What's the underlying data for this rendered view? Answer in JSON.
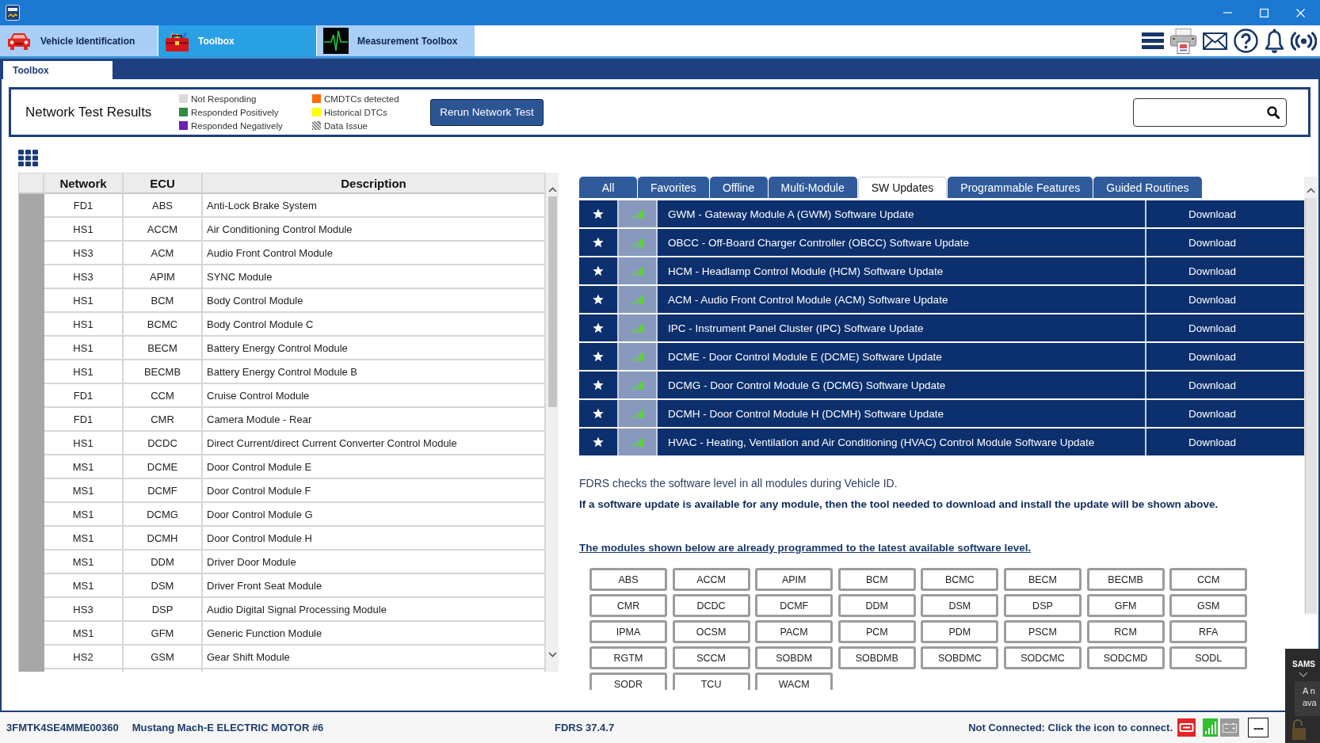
{
  "app_tabs": [
    {
      "label": "Vehicle Identification",
      "kind": "car",
      "selected": false
    },
    {
      "label": "Toolbox",
      "kind": "toolbox",
      "selected": true
    },
    {
      "label": "Measurement Toolbox",
      "kind": "waveform",
      "selected": false
    }
  ],
  "sub_tabs": [
    {
      "label": "Toolbox",
      "selected": true
    }
  ],
  "network_test": {
    "title": "Network Test Results",
    "legend": [
      {
        "label": "Not Responding",
        "kind": "solid",
        "color": "#d9d9d9"
      },
      {
        "label": "Responded Positively",
        "kind": "solid",
        "color": "#2e8b3f"
      },
      {
        "label": "Responded Negatively",
        "kind": "solid",
        "color": "#6a1fb5"
      },
      {
        "label": "CMDTCs detected",
        "kind": "solid",
        "color": "#ff6c0a"
      },
      {
        "label": "Historical DTCs",
        "kind": "solid",
        "color": "#ffff00"
      },
      {
        "label": "Data Issue",
        "kind": "hatched",
        "color": "#7f7f7f"
      }
    ],
    "rerun_button": "Rerun Network Test"
  },
  "ecu_table": {
    "columns": [
      "Network",
      "ECU",
      "Description"
    ],
    "rows": [
      {
        "network": "FD1",
        "ecu": "ABS",
        "description": "Anti-Lock Brake System"
      },
      {
        "network": "HS1",
        "ecu": "ACCM",
        "description": "Air Conditioning Control Module"
      },
      {
        "network": "HS3",
        "ecu": "ACM",
        "description": "Audio Front Control Module"
      },
      {
        "network": "HS3",
        "ecu": "APIM",
        "description": "SYNC Module"
      },
      {
        "network": "HS1",
        "ecu": "BCM",
        "description": "Body Control Module"
      },
      {
        "network": "HS1",
        "ecu": "BCMC",
        "description": "Body Control Module C"
      },
      {
        "network": "HS1",
        "ecu": "BECM",
        "description": "Battery Energy Control Module"
      },
      {
        "network": "HS1",
        "ecu": "BECMB",
        "description": "Battery Energy Control Module B"
      },
      {
        "network": "FD1",
        "ecu": "CCM",
        "description": "Cruise Control Module"
      },
      {
        "network": "FD1",
        "ecu": "CMR",
        "description": "Camera Module - Rear"
      },
      {
        "network": "HS1",
        "ecu": "DCDC",
        "description": "Direct Current/direct Current Converter Control Module"
      },
      {
        "network": "MS1",
        "ecu": "DCME",
        "description": "Door Control Module E"
      },
      {
        "network": "MS1",
        "ecu": "DCMF",
        "description": "Door Control Module F"
      },
      {
        "network": "MS1",
        "ecu": "DCMG",
        "description": "Door Control Module G"
      },
      {
        "network": "MS1",
        "ecu": "DCMH",
        "description": "Door Control Module H"
      },
      {
        "network": "MS1",
        "ecu": "DDM",
        "description": "Driver Door Module"
      },
      {
        "network": "MS1",
        "ecu": "DSM",
        "description": "Driver Front Seat Module"
      },
      {
        "network": "HS3",
        "ecu": "DSP",
        "description": "Audio Digital Signal Processing Module"
      },
      {
        "network": "MS1",
        "ecu": "GFM",
        "description": "Generic Function Module"
      },
      {
        "network": "HS2",
        "ecu": "GSM",
        "description": "Gear Shift Module"
      }
    ]
  },
  "filter_tabs": [
    {
      "label": "All",
      "selected": false
    },
    {
      "label": "Favorites",
      "selected": false
    },
    {
      "label": "Offline",
      "selected": false
    },
    {
      "label": "Multi-Module",
      "selected": false
    },
    {
      "label": "SW Updates",
      "selected": true
    },
    {
      "label": "Programmable Features",
      "selected": false
    },
    {
      "label": "Guided Routines",
      "selected": false
    }
  ],
  "sw_updates": [
    {
      "title": "GWM - Gateway Module A (GWM) Software Update",
      "action": "Download"
    },
    {
      "title": "OBCC - Off-Board Charger Controller (OBCC) Software Update",
      "action": "Download"
    },
    {
      "title": "HCM - Headlamp Control Module (HCM) Software Update",
      "action": "Download"
    },
    {
      "title": "ACM - Audio Front Control Module (ACM) Software Update",
      "action": "Download"
    },
    {
      "title": "IPC - Instrument Panel Cluster (IPC) Software Update",
      "action": "Download"
    },
    {
      "title": "DCME - Door Control Module E (DCME) Software Update",
      "action": "Download"
    },
    {
      "title": "DCMG - Door Control Module G (DCMG) Software Update",
      "action": "Download"
    },
    {
      "title": "DCMH - Door Control Module H (DCMH) Software Update",
      "action": "Download"
    },
    {
      "title": "HVAC - Heating, Ventilation and Air Conditioning (HVAC) Control Module Software Update",
      "action": "Download"
    }
  ],
  "notes": {
    "info": "FDRS checks the software level in all modules during Vehicle ID.",
    "instruction": "If a software update is available for any module, then the tool needed to download and install the update will be shown above.",
    "link": "The modules shown below are already programmed to the latest available software level."
  },
  "up_to_date_modules": [
    "ABS",
    "ACCM",
    "APIM",
    "BCM",
    "BCMC",
    "BECM",
    "BECMB",
    "CCM",
    "CMR",
    "DCDC",
    "DCMF",
    "DDM",
    "DSM",
    "DSP",
    "GFM",
    "GSM",
    "IPMA",
    "OCSM",
    "PACM",
    "PCM",
    "PDM",
    "PSCM",
    "RCM",
    "RFA",
    "RGTM",
    "SCCM",
    "SOBDM",
    "SOBDMB",
    "SOBDMC",
    "SODCMC",
    "SODCMD",
    "SODL",
    "SODR",
    "TCU",
    "WACM"
  ],
  "status_bar": {
    "vin": "3FMTK4SE4MME00360",
    "vehicle": "Mustang Mach-E ELECTRIC MOTOR #6",
    "version": "FDRS 37.4.7",
    "connection_message": "Not Connected: Click the icon to connect.",
    "indicator": "---"
  },
  "notification": {
    "title": "SAMS",
    "lines": [
      "A n",
      "ava"
    ]
  }
}
